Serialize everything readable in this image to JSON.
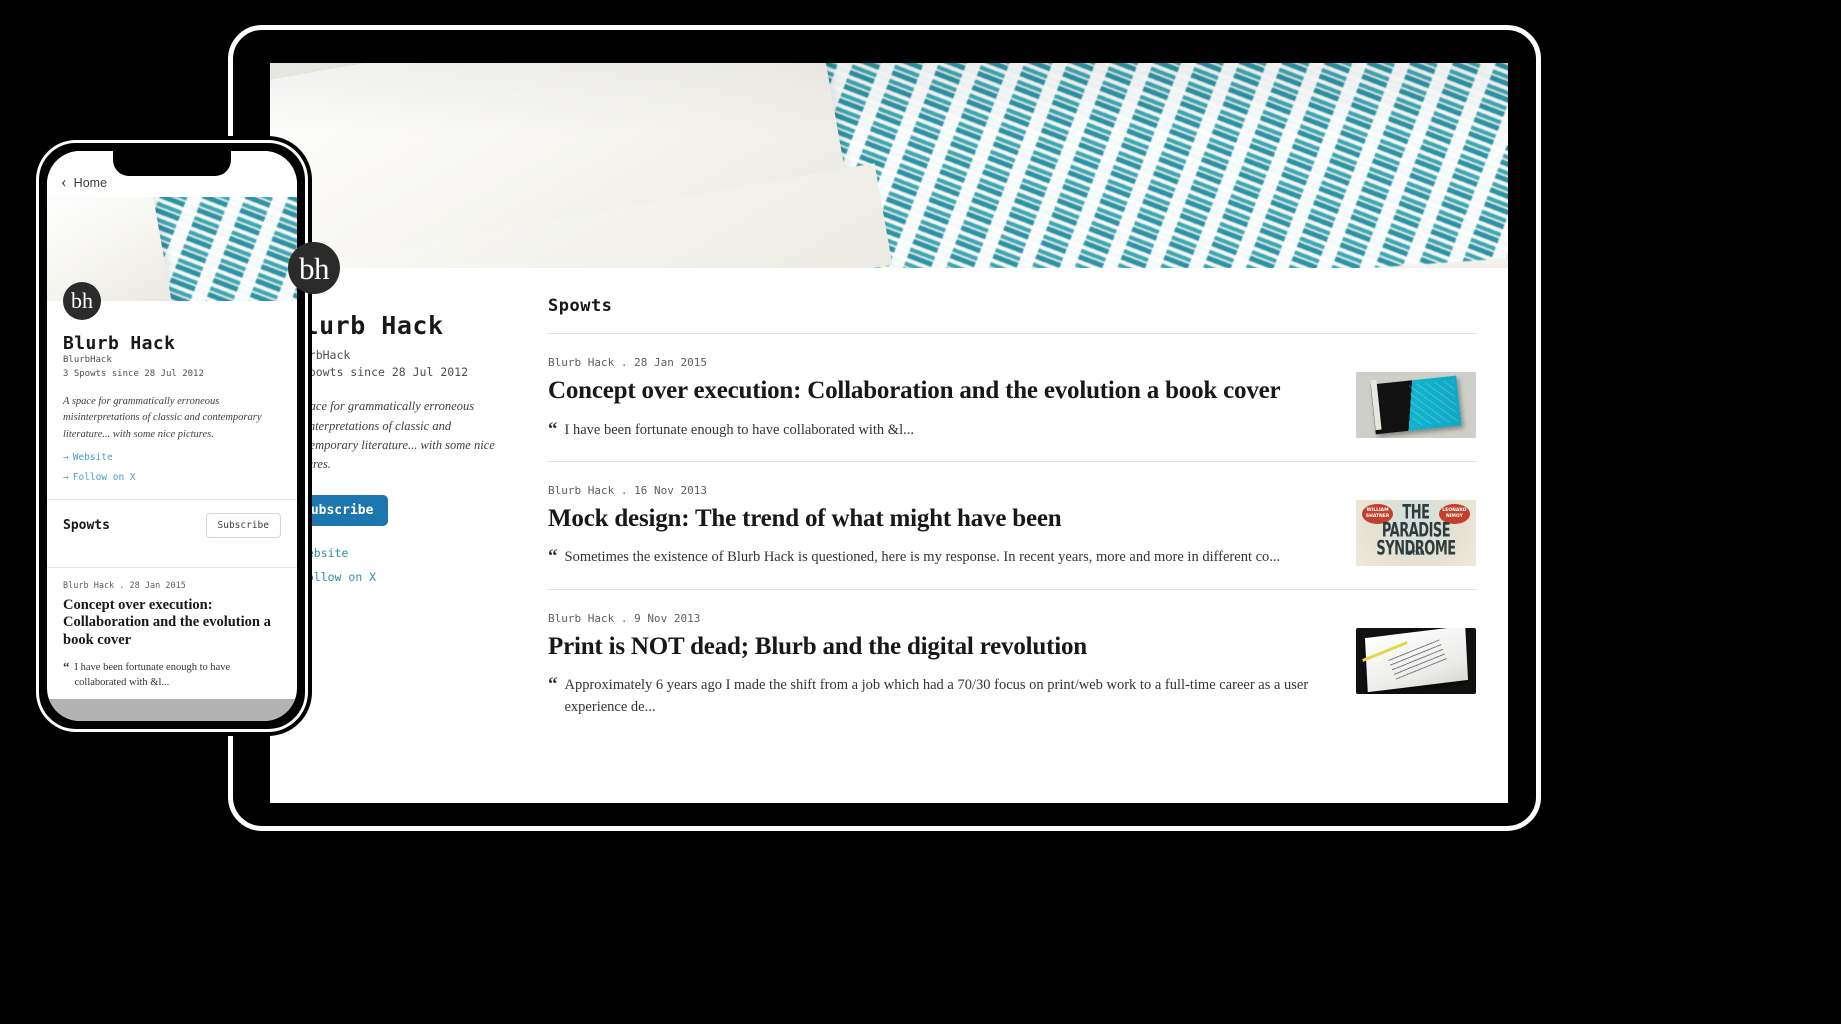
{
  "profile": {
    "avatar_initials": "bh",
    "title": "Blurb Hack",
    "handle": "BlurbHack",
    "stats": "3 Spowts since 28 Jul 2012",
    "bio": "A space for grammatically erroneous misinterpretations of classic and contemporary literature... with some nice pictures.",
    "subscribe_label": "Subscribe",
    "links": [
      {
        "arrow": "→",
        "label": "Website"
      },
      {
        "arrow": "→",
        "label": "Follow on X"
      }
    ]
  },
  "feed": {
    "heading": "Spowts",
    "quote_mark": "“",
    "posts": [
      {
        "meta": "Blurb Hack . 28 Jan 2015",
        "title": "Concept over execution: Collaboration and the evolution a book cover",
        "excerpt": "I have been fortunate enough to have collaborated with &l...",
        "thumb_alt": "book-cover-the-great-wash"
      },
      {
        "meta": "Blurb Hack . 16 Nov 2013",
        "title": "Mock design: The trend of what might have been",
        "excerpt": "Sometimes the existence of Blurb Hack is questioned, here is my response. In recent years, more and more in different co...",
        "thumb_alt": "paradise-syndrome-poster"
      },
      {
        "meta": "Blurb Hack . 9 Nov 2013",
        "title": "Print is NOT dead; Blurb and the digital revolution",
        "excerpt": "Approximately 6 years ago I made the shift from a job which had a 70/30 focus on print/web work to a full-time career as a user experience de...",
        "thumb_alt": "open-book-spread"
      }
    ]
  },
  "phone": {
    "nav_back_glyph": "‹",
    "nav_label": "Home",
    "subscribe_label": "Subscribe",
    "post": {
      "meta": "Blurb Hack . 28 Jan 2015",
      "title": "Concept over execution: Collaboration and the evolution a book cover",
      "excerpt": "I have been fortunate enough to have collaborated with &l..."
    }
  },
  "thumb2_text": {
    "line1": "THE",
    "line2": "PARADISE",
    "line3": "SYNDROME",
    "badge_left": "WILLIAM SHATNER",
    "badge_right": "LEONARD NIMOY",
    "star": "STAR"
  },
  "colors": {
    "accent_blue": "#1b77ad",
    "link_teal": "#2e8ea8",
    "background": "#000000"
  }
}
